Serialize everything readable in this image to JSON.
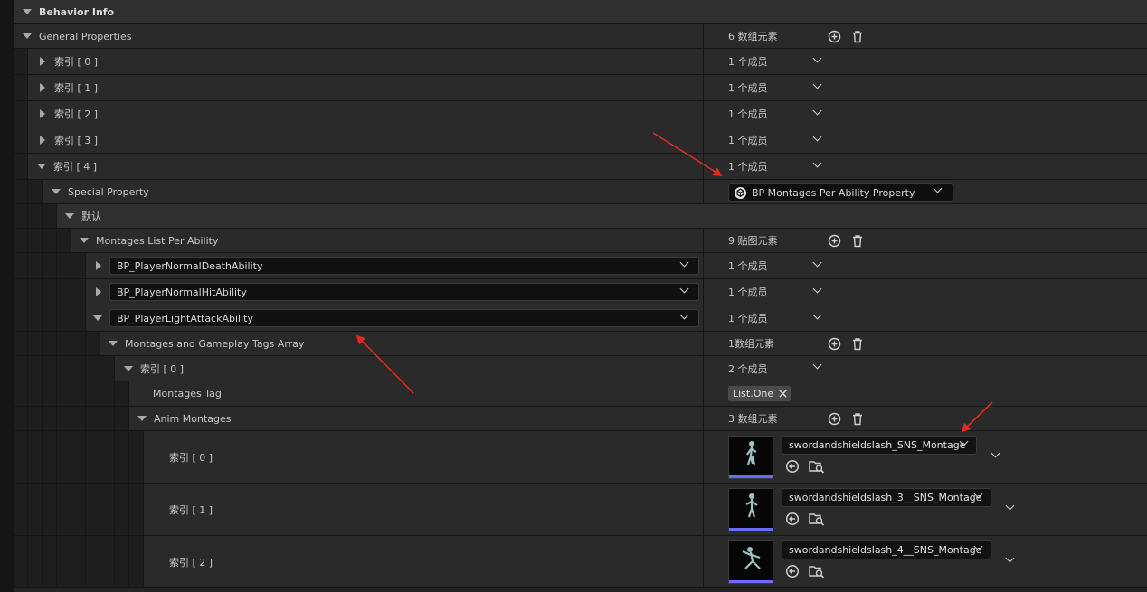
{
  "header": {
    "title": "Behavior Info"
  },
  "general": {
    "label": "General Properties",
    "count": "6 数组元素"
  },
  "indices": [
    {
      "label": "索引 [ 0 ]",
      "value": "1 个成员"
    },
    {
      "label": "索引 [ 1 ]",
      "value": "1 个成员"
    },
    {
      "label": "索引 [ 2 ]",
      "value": "1 个成员"
    },
    {
      "label": "索引 [ 3 ]",
      "value": "1 个成员"
    },
    {
      "label": "索引 [ 4 ]",
      "value": "1 个成员"
    }
  ],
  "special_property": {
    "label": "Special Property",
    "value": "BP Montages Per Ability Property"
  },
  "default_group": {
    "label": "默认"
  },
  "montages_list": {
    "label": "Montages List Per Ability",
    "count": "9 贴图元素"
  },
  "abilities": [
    {
      "name": "BP_PlayerNormalDeathAbility",
      "value": "1 个成员"
    },
    {
      "name": "BP_PlayerNormalHitAbility",
      "value": "1 个成员"
    },
    {
      "name": "BP_PlayerLightAttackAbility",
      "value": "1 个成员"
    }
  ],
  "tags_array": {
    "label": "Montages and Gameplay Tags Array",
    "count": "1数组元素"
  },
  "tags_index": {
    "label": "索引 [ 0 ]",
    "value": "2 个成员"
  },
  "montages_tag": {
    "label": "Montages Tag",
    "value": "List.One"
  },
  "anim_montages": {
    "label": "Anim Montages",
    "count": "3 数组元素"
  },
  "montage_items": [
    {
      "label": "索引 [ 0 ]",
      "asset": "swordandshieldslash_SNS_Montage"
    },
    {
      "label": "索引 [ 1 ]",
      "asset": "swordandshieldslash_3__SNS_Montage"
    },
    {
      "label": "索引 [ 2 ]",
      "asset": "swordandshieldslash_4__SNS_Montage"
    }
  ],
  "icons": {
    "add": "add-circle-icon",
    "delete": "trash-icon",
    "browse": "browse-to-asset-icon",
    "use": "use-selected-asset-icon"
  },
  "colors": {
    "annotation_arrow": "#e8271f",
    "thumbnail_bar": "#6b6bff"
  }
}
